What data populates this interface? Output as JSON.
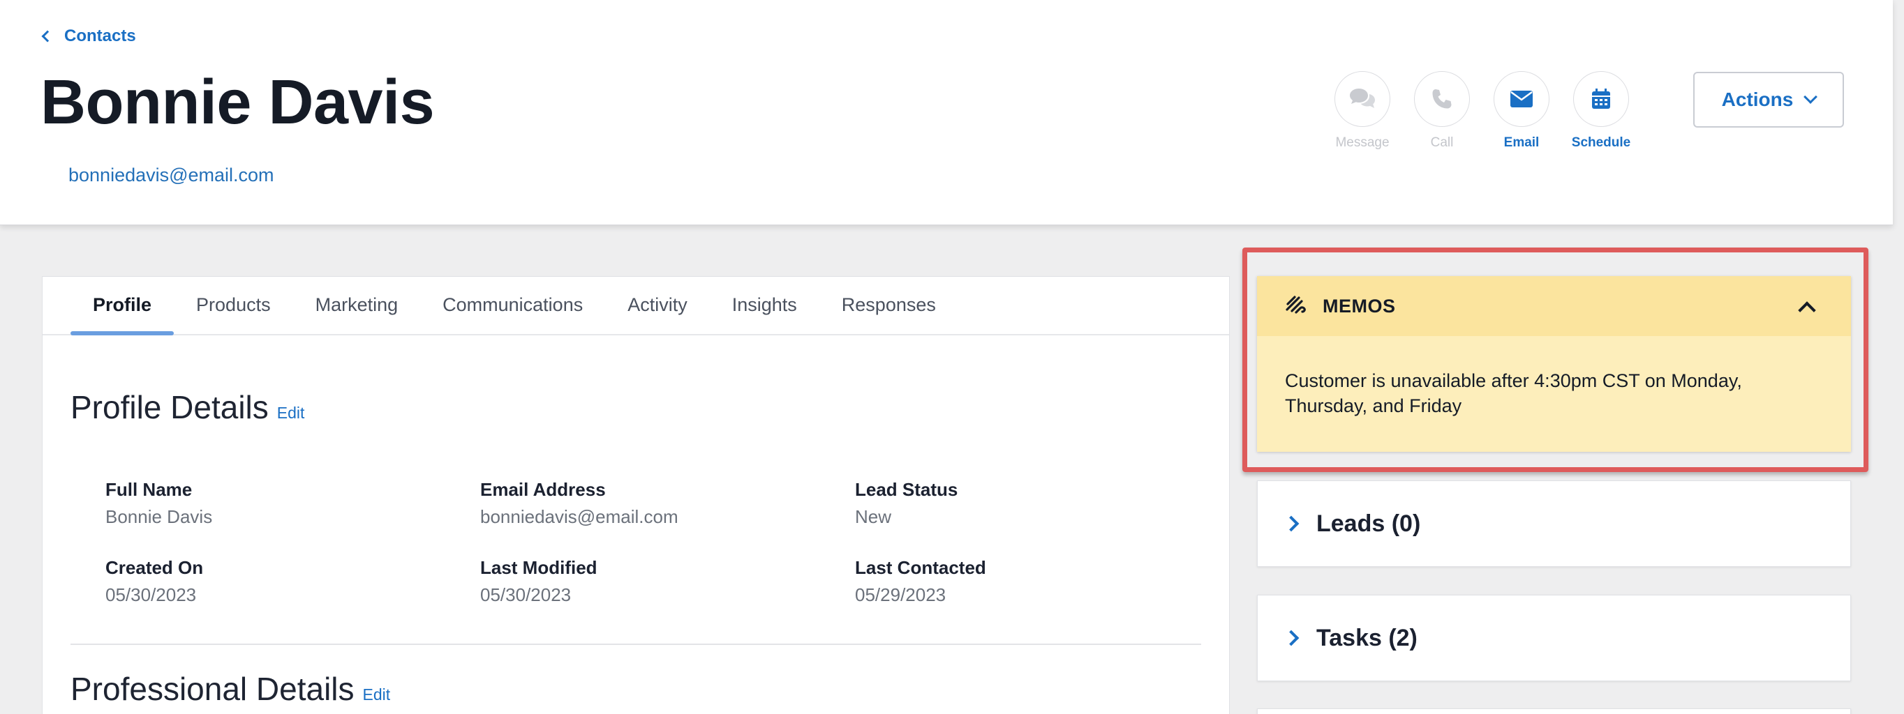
{
  "header": {
    "back_label": "Contacts",
    "name": "Bonnie Davis",
    "email": "bonniedavis@email.com",
    "quick_actions": [
      {
        "label": "Message",
        "icon": "message-icon",
        "enabled": false
      },
      {
        "label": "Call",
        "icon": "phone-icon",
        "enabled": false
      },
      {
        "label": "Email",
        "icon": "envelope-icon",
        "enabled": true
      },
      {
        "label": "Schedule",
        "icon": "calendar-icon",
        "enabled": true
      }
    ],
    "actions_label": "Actions"
  },
  "tabs": [
    {
      "label": "Profile",
      "active": true
    },
    {
      "label": "Products"
    },
    {
      "label": "Marketing"
    },
    {
      "label": "Communications"
    },
    {
      "label": "Activity"
    },
    {
      "label": "Insights"
    },
    {
      "label": "Responses"
    }
  ],
  "profile": {
    "title": "Profile Details",
    "edit_label": "Edit",
    "fields": [
      {
        "label": "Full Name",
        "value": "Bonnie Davis"
      },
      {
        "label": "Email Address",
        "value": "bonniedavis@email.com"
      },
      {
        "label": "Lead Status",
        "value": "New"
      },
      {
        "label": "Created On",
        "value": "05/30/2023"
      },
      {
        "label": "Last Modified",
        "value": "05/30/2023"
      },
      {
        "label": "Last Contacted",
        "value": "05/29/2023"
      }
    ]
  },
  "professional": {
    "title": "Professional Details",
    "edit_label": "Edit"
  },
  "memos": {
    "title": "MEMOS",
    "text": "Customer is unavailable after 4:30pm CST on Monday, Thursday, and Friday"
  },
  "leads": {
    "title": "Leads (0)"
  },
  "tasks": {
    "title": "Tasks (2)"
  },
  "colors": {
    "accent": "#1a6fc4",
    "memo_header_bg": "#fbe49e",
    "memo_body_bg": "#fdeebb",
    "highlight": "#de5b5b"
  }
}
